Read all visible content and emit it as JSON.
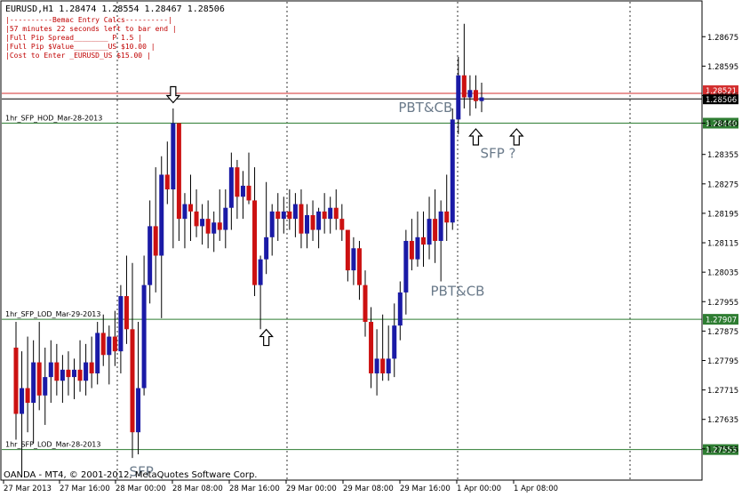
{
  "symbol_header": "EURUSD,H1  1.28474 1.28554 1.28467 1.28506",
  "calc_box": {
    "lines": [
      "|----------Bemac Entry Calcs----------|",
      "|57 minutes 22 seconds left to bar end |",
      "|Full Pip Spread________   P 1.5      |",
      "|Full Pip $Value________US $10.00     |",
      "|Cost to Enter  _EURUSD_US $15.00     |"
    ],
    "color": "#c00000"
  },
  "copyright": "OANDA - MT4, © 2001-2012, MetaQuotes Software Corp.",
  "chart_data": {
    "type": "candlestick",
    "ylim": [
      1.2745,
      1.2887
    ],
    "y_ticks": [
      "1.28675",
      "1.28595",
      "1.28515",
      "1.28440",
      "1.28355",
      "1.28275",
      "1.28195",
      "1.28115",
      "1.28035",
      "1.27955",
      "1.27875",
      "1.27795",
      "1.27715",
      "1.27635",
      "1.27555"
    ],
    "x_ticks": [
      "27 Mar 2013",
      "27 Mar 16:00",
      "28 Mar 00:00",
      "28 Mar 08:00",
      "28 Mar 16:00",
      "29 Mar 00:00",
      "29 Mar 08:00",
      "29 Mar 16:00",
      "1 Apr 00:00",
      "1 Apr 08:00"
    ],
    "vertical_grid_after_bars": [
      16,
      24,
      40,
      64,
      70,
      80
    ],
    "levels": [
      {
        "name": "1hr_SFP_HOD_Mar-28-2013",
        "value": 1.2844,
        "label": "1.28440",
        "color": "#2e7d32"
      },
      {
        "name": "1hr_SFP_LOD_Mar-29-2013",
        "value": 1.27907,
        "label": "1.27907",
        "color": "#2e7d32"
      },
      {
        "name": "1hr_SFP_LOD_Mar-28-2013",
        "value": 1.27553,
        "label": "1.27553",
        "color": "#2e7d32"
      }
    ],
    "ask_line": {
      "value": 1.28521,
      "label": "1.28521",
      "color": "#d32f2f"
    },
    "bid_line": {
      "value": 1.28506,
      "label": "1.28506",
      "color": "#000000"
    },
    "bull_color": "#1a1aa6",
    "bear_color": "#cc1111",
    "candles": [
      {
        "o": 1.2783,
        "h": 1.279,
        "l": 1.2758,
        "c": 1.2765
      },
      {
        "o": 1.2765,
        "h": 1.2782,
        "l": 1.2748,
        "c": 1.2772
      },
      {
        "o": 1.2772,
        "h": 1.2786,
        "l": 1.276,
        "c": 1.2768
      },
      {
        "o": 1.2768,
        "h": 1.2785,
        "l": 1.2757,
        "c": 1.2779
      },
      {
        "o": 1.2779,
        "h": 1.279,
        "l": 1.2766,
        "c": 1.277
      },
      {
        "o": 1.277,
        "h": 1.2783,
        "l": 1.2762,
        "c": 1.2775
      },
      {
        "o": 1.2775,
        "h": 1.2785,
        "l": 1.2768,
        "c": 1.2779
      },
      {
        "o": 1.2779,
        "h": 1.2784,
        "l": 1.277,
        "c": 1.2774
      },
      {
        "o": 1.2774,
        "h": 1.2781,
        "l": 1.2768,
        "c": 1.2777
      },
      {
        "o": 1.2777,
        "h": 1.2782,
        "l": 1.277,
        "c": 1.2775
      },
      {
        "o": 1.2775,
        "h": 1.278,
        "l": 1.2769,
        "c": 1.2777
      },
      {
        "o": 1.2777,
        "h": 1.2785,
        "l": 1.2771,
        "c": 1.2774
      },
      {
        "o": 1.2774,
        "h": 1.2784,
        "l": 1.277,
        "c": 1.2779
      },
      {
        "o": 1.2779,
        "h": 1.2786,
        "l": 1.2772,
        "c": 1.2776
      },
      {
        "o": 1.2776,
        "h": 1.279,
        "l": 1.2773,
        "c": 1.2787
      },
      {
        "o": 1.2787,
        "h": 1.2792,
        "l": 1.2778,
        "c": 1.2781
      },
      {
        "o": 1.2781,
        "h": 1.2789,
        "l": 1.2773,
        "c": 1.2786
      },
      {
        "o": 1.2786,
        "h": 1.2793,
        "l": 1.2778,
        "c": 1.2782
      },
      {
        "o": 1.2782,
        "h": 1.28,
        "l": 1.2776,
        "c": 1.2797
      },
      {
        "o": 1.2797,
        "h": 1.2808,
        "l": 1.2784,
        "c": 1.2788
      },
      {
        "o": 1.2788,
        "h": 1.2806,
        "l": 1.2753,
        "c": 1.276
      },
      {
        "o": 1.276,
        "h": 1.279,
        "l": 1.2754,
        "c": 1.2772
      },
      {
        "o": 1.2772,
        "h": 1.2808,
        "l": 1.277,
        "c": 1.28
      },
      {
        "o": 1.28,
        "h": 1.2823,
        "l": 1.2795,
        "c": 1.2816
      },
      {
        "o": 1.2816,
        "h": 1.2832,
        "l": 1.2798,
        "c": 1.2808
      },
      {
        "o": 1.2808,
        "h": 1.2835,
        "l": 1.2791,
        "c": 1.283
      },
      {
        "o": 1.283,
        "h": 1.2839,
        "l": 1.2822,
        "c": 1.2826
      },
      {
        "o": 1.2826,
        "h": 1.2848,
        "l": 1.281,
        "c": 1.2844
      },
      {
        "o": 1.2844,
        "h": 1.2844,
        "l": 1.2812,
        "c": 1.2818
      },
      {
        "o": 1.2818,
        "h": 1.2825,
        "l": 1.281,
        "c": 1.2822
      },
      {
        "o": 1.2822,
        "h": 1.283,
        "l": 1.2812,
        "c": 1.282
      },
      {
        "o": 1.282,
        "h": 1.2826,
        "l": 1.2813,
        "c": 1.2816
      },
      {
        "o": 1.2816,
        "h": 1.2822,
        "l": 1.2811,
        "c": 1.2818
      },
      {
        "o": 1.2818,
        "h": 1.2823,
        "l": 1.281,
        "c": 1.2814
      },
      {
        "o": 1.2814,
        "h": 1.282,
        "l": 1.2809,
        "c": 1.2817
      },
      {
        "o": 1.2817,
        "h": 1.2826,
        "l": 1.2812,
        "c": 1.2815
      },
      {
        "o": 1.2815,
        "h": 1.2826,
        "l": 1.281,
        "c": 1.2821
      },
      {
        "o": 1.2821,
        "h": 1.2836,
        "l": 1.2815,
        "c": 1.2832
      },
      {
        "o": 1.2832,
        "h": 1.2834,
        "l": 1.2818,
        "c": 1.2824
      },
      {
        "o": 1.2824,
        "h": 1.2831,
        "l": 1.2818,
        "c": 1.2827
      },
      {
        "o": 1.2827,
        "h": 1.2836,
        "l": 1.2822,
        "c": 1.2823
      },
      {
        "o": 1.2823,
        "h": 1.2832,
        "l": 1.2797,
        "c": 1.28
      },
      {
        "o": 1.28,
        "h": 1.2808,
        "l": 1.2788,
        "c": 1.2807
      },
      {
        "o": 1.2807,
        "h": 1.2828,
        "l": 1.2803,
        "c": 1.2813
      },
      {
        "o": 1.2813,
        "h": 1.2822,
        "l": 1.2808,
        "c": 1.282
      },
      {
        "o": 1.282,
        "h": 1.2825,
        "l": 1.2812,
        "c": 1.2818
      },
      {
        "o": 1.2818,
        "h": 1.2824,
        "l": 1.2814,
        "c": 1.282
      },
      {
        "o": 1.282,
        "h": 1.2826,
        "l": 1.2815,
        "c": 1.2818
      },
      {
        "o": 1.2818,
        "h": 1.2825,
        "l": 1.2813,
        "c": 1.2822
      },
      {
        "o": 1.2822,
        "h": 1.2826,
        "l": 1.281,
        "c": 1.2814
      },
      {
        "o": 1.2814,
        "h": 1.2822,
        "l": 1.281,
        "c": 1.2819
      },
      {
        "o": 1.2819,
        "h": 1.2823,
        "l": 1.2812,
        "c": 1.2815
      },
      {
        "o": 1.2815,
        "h": 1.2821,
        "l": 1.281,
        "c": 1.282
      },
      {
        "o": 1.282,
        "h": 1.2825,
        "l": 1.2814,
        "c": 1.2818
      },
      {
        "o": 1.2818,
        "h": 1.2824,
        "l": 1.2814,
        "c": 1.2821
      },
      {
        "o": 1.2821,
        "h": 1.2826,
        "l": 1.2815,
        "c": 1.2818
      },
      {
        "o": 1.2818,
        "h": 1.2822,
        "l": 1.2812,
        "c": 1.2815
      },
      {
        "o": 1.2815,
        "h": 1.2812,
        "l": 1.2801,
        "c": 1.2804
      },
      {
        "o": 1.2804,
        "h": 1.2813,
        "l": 1.28,
        "c": 1.281
      },
      {
        "o": 1.281,
        "h": 1.2812,
        "l": 1.2796,
        "c": 1.28
      },
      {
        "o": 1.28,
        "h": 1.2804,
        "l": 1.2786,
        "c": 1.279
      },
      {
        "o": 1.279,
        "h": 1.2794,
        "l": 1.2772,
        "c": 1.2776
      },
      {
        "o": 1.2776,
        "h": 1.2788,
        "l": 1.277,
        "c": 1.278
      },
      {
        "o": 1.278,
        "h": 1.2792,
        "l": 1.2774,
        "c": 1.2776
      },
      {
        "o": 1.2776,
        "h": 1.2789,
        "l": 1.2774,
        "c": 1.278
      },
      {
        "o": 1.278,
        "h": 1.2795,
        "l": 1.2775,
        "c": 1.2789
      },
      {
        "o": 1.2789,
        "h": 1.2801,
        "l": 1.2785,
        "c": 1.2798
      },
      {
        "o": 1.2798,
        "h": 1.2815,
        "l": 1.2792,
        "c": 1.2812
      },
      {
        "o": 1.2812,
        "h": 1.2818,
        "l": 1.2804,
        "c": 1.2807
      },
      {
        "o": 1.2807,
        "h": 1.282,
        "l": 1.2805,
        "c": 1.2813
      },
      {
        "o": 1.2813,
        "h": 1.282,
        "l": 1.2805,
        "c": 1.2811
      },
      {
        "o": 1.2811,
        "h": 1.2824,
        "l": 1.2807,
        "c": 1.2818
      },
      {
        "o": 1.2818,
        "h": 1.2826,
        "l": 1.2806,
        "c": 1.2812
      },
      {
        "o": 1.2812,
        "h": 1.2823,
        "l": 1.2801,
        "c": 1.282
      },
      {
        "o": 1.282,
        "h": 1.283,
        "l": 1.2812,
        "c": 1.2817
      },
      {
        "o": 1.2817,
        "h": 1.2848,
        "l": 1.2815,
        "c": 1.2845
      },
      {
        "o": 1.2845,
        "h": 1.2862,
        "l": 1.2841,
        "c": 1.2857
      },
      {
        "o": 1.2857,
        "h": 1.2871,
        "l": 1.2848,
        "c": 1.2851
      },
      {
        "o": 1.2851,
        "h": 1.2857,
        "l": 1.2846,
        "c": 1.2853
      },
      {
        "o": 1.2853,
        "h": 1.2857,
        "l": 1.2848,
        "c": 1.285
      },
      {
        "o": 1.285,
        "h": 1.2855,
        "l": 1.2847,
        "c": 1.2851
      }
    ],
    "annotations": [
      {
        "text": "PBT&CB",
        "bar": 77,
        "price": 1.2846,
        "dx": -74,
        "dy": -4,
        "color": "#6a7a8a"
      },
      {
        "text": "PBT&CB",
        "bar": 70,
        "price": 1.27986,
        "dx": 8,
        "dy": 6,
        "color": "#6a7a8a"
      },
      {
        "text": "SFP ?",
        "bar": 81,
        "price": 1.28355,
        "dx": -8,
        "dy": 4,
        "color": "#6a7a8a"
      },
      {
        "text": "SFP",
        "bar": 21,
        "price": 1.275,
        "dx": -10,
        "dy": 8,
        "color": "#6a7a8a"
      }
    ],
    "arrows": [
      {
        "bar": 27,
        "price": 1.28515,
        "dir": "down"
      },
      {
        "bar": 43,
        "price": 1.2786,
        "dir": "up"
      },
      {
        "bar": 79,
        "price": 1.28405,
        "dir": "up"
      },
      {
        "bar": 86,
        "price": 1.28405,
        "dir": "up"
      }
    ]
  }
}
